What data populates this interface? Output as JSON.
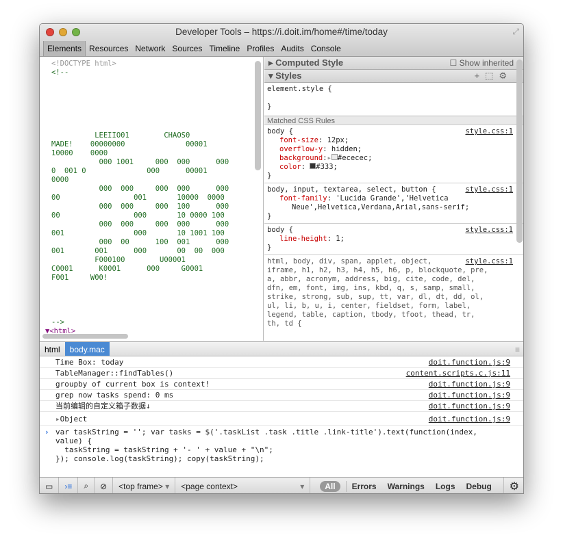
{
  "window": {
    "title": "Developer Tools – https://i.doit.im/home#/time/today"
  },
  "tabs": [
    {
      "label": "Elements",
      "selected": true
    },
    {
      "label": "Resources"
    },
    {
      "label": "Network"
    },
    {
      "label": "Sources"
    },
    {
      "label": "Timeline"
    },
    {
      "label": "Profiles"
    },
    {
      "label": "Audits"
    },
    {
      "label": "Console"
    }
  ],
  "elements": {
    "doctype": "<!DOCTYPE html>",
    "comment_open": "<!--",
    "comment_close": "-->",
    "html_tag": "<html>",
    "ascii_art": "          LEEIIO01        CHAOS0\nMADE!    00000000              00001\n10000    0000\n           000 1001     000  000      000\n0  001 0              000      00001\n0000\n           000  000     000  000      000\n00                 001       10000  0000\n           000  000     000  100      000\n00                 000       10 0000 100\n           000  000     000  000      000\n001                000       10 1001 100\n           000  00      100  001      000\n001       001      000       00  00  000\n          F000100        U00001\nC0001      K0001      000     G0001\nF001     W00!"
  },
  "styles": {
    "computed_label": "Computed Style",
    "show_inherited": "Show inherited",
    "styles_label": "Styles",
    "matched_label": "Matched CSS Rules",
    "element_style": "element.style {",
    "close": "}",
    "rules": [
      {
        "selector": "body {",
        "source": "style.css:1",
        "props": [
          [
            "font-size",
            "12px;"
          ],
          [
            "overflow-y",
            "hidden;"
          ],
          [
            "background",
            "#ececec;"
          ],
          [
            "color",
            "#333;"
          ]
        ]
      },
      {
        "selector": "body, input, textarea, select, button {",
        "source": "style.css:1",
        "props": [
          [
            "font-family",
            "'Lucida Grande','Helvetica"
          ]
        ],
        "cont": "Neue',Helvetica,Verdana,Arial,sans-serif;"
      },
      {
        "selector": "body {",
        "source": "style.css:1",
        "props": [
          [
            "line-height",
            "1;"
          ]
        ]
      },
      {
        "selector": "html, body, div, span, applet, object,",
        "source": "style.css:1",
        "more": "iframe, h1, h2, h3, h4, h5, h6, p, blockquote, pre,\na, abbr, acronym, address, big, cite, code, del,\ndfn, em, font, img, ins, kbd, q, s, samp, small,\nstrike, strong, sub, sup, tt, var, dl, dt, dd, ol,\nul, li, b, u, i, center, fieldset, form, label,\nlegend, table, caption, tbody, tfoot, thead, tr,\nth, td {"
      }
    ],
    "colors": {
      "background": "#ececec",
      "color": "#333333"
    }
  },
  "breadcrumbs": [
    {
      "label": "html"
    },
    {
      "label": "body.mac",
      "selected": true
    }
  ],
  "console": {
    "messages": [
      {
        "text": "Time Box: today",
        "source": "doit.function.js:9"
      },
      {
        "text": "TableManager::findTables()",
        "source": "content.scripts.c.js:11"
      },
      {
        "text": "groupby of current box is context!",
        "source": "doit.function.js:9"
      },
      {
        "text": "grep now tasks spend: 0 ms",
        "source": "doit.function.js:9"
      },
      {
        "text": "当前编辑的自定义箱子数据↓",
        "source": "doit.function.js:9"
      },
      {
        "text": "Object",
        "source": "doit.function.js:9"
      }
    ],
    "input": "var taskString = ''; var tasks = $('.taskList .task .title .link-title').text(function(index,\nvalue) {\n  taskString = taskString + '- ' + value + \"\\n\";\n}); console.log(taskString); copy(taskString);"
  },
  "statusbar": {
    "frame": "<top frame>",
    "context": "<page context>",
    "filters": [
      "All",
      "Errors",
      "Warnings",
      "Logs",
      "Debug"
    ]
  }
}
